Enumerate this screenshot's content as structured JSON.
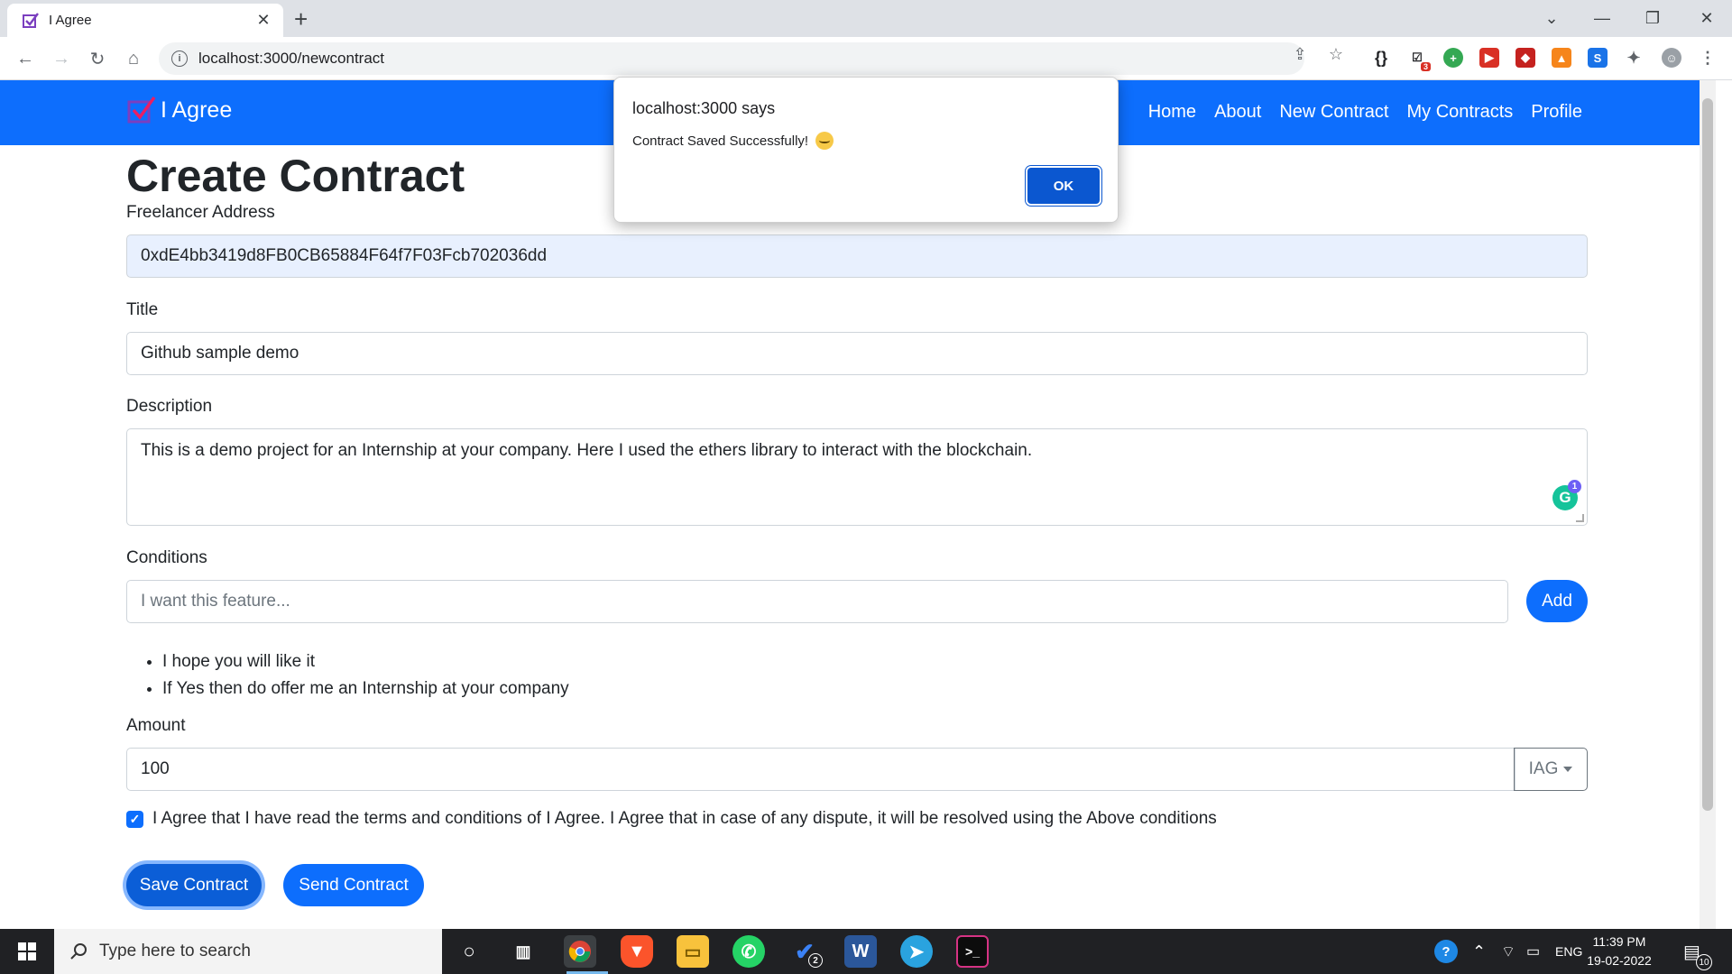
{
  "browser": {
    "tab_title": "I Agree",
    "tab_close": "✕",
    "new_tab": "+",
    "url": "localhost:3000/newcontract",
    "extension_badge": "3",
    "window_controls": {
      "tabs_dropdown": "⌄",
      "minimize": "—",
      "maximize": "❐",
      "close": "✕"
    }
  },
  "navbar": {
    "brand": "I Agree",
    "links": [
      "Home",
      "About",
      "New Contract",
      "My Contracts",
      "Profile"
    ]
  },
  "form": {
    "heading": "Create Contract",
    "freelancer_label": "Freelancer Address",
    "freelancer_value": "0xdE4bb3419d8FB0CB65884F64f7F03Fcb702036dd",
    "title_label": "Title",
    "title_value": "Github sample demo",
    "description_label": "Description",
    "description_value": "This is a demo project for an Internship at your company. Here I used the ethers library to interact with the blockchain.",
    "grammarly_count": "1",
    "conditions_label": "Conditions",
    "conditions_placeholder": "I want this feature...",
    "add_label": "Add",
    "conditions": [
      "I hope you will like it",
      "If Yes then do offer me an Internship at your company"
    ],
    "amount_label": "Amount",
    "amount_value": "100",
    "currency": "IAG",
    "agree_text": "I Agree that I have read the terms and conditions of I Agree. I Agree that in case of any dispute, it will be resolved using the Above conditions",
    "agree_checked": true,
    "save_label": "Save Contract",
    "send_label": "Send Contract"
  },
  "dialog": {
    "title": "localhost:3000 says",
    "message": "Contract Saved Successfully!",
    "ok_label": "OK"
  },
  "taskbar": {
    "search_placeholder": "Type here to search",
    "vscode_badge": "2",
    "language": "ENG",
    "time": "11:39 PM",
    "date": "19-02-2022",
    "notifications": "10"
  },
  "colors": {
    "primary": "#0d6efd",
    "navbar": "#0d6efd",
    "taskbar": "#202124"
  }
}
